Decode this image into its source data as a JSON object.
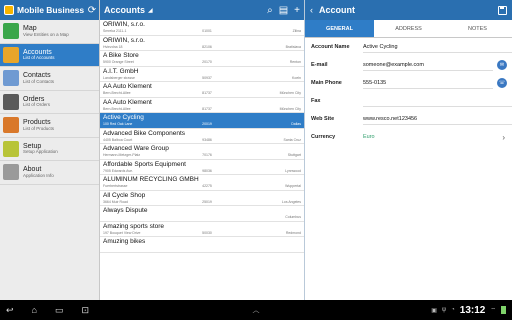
{
  "left": {
    "title": "Mobile Business...",
    "items": [
      {
        "label": "Map",
        "sub": "View Entities on a Map",
        "icon": "map-icon",
        "active": false,
        "color": "#3aa64a"
      },
      {
        "label": "Accounts",
        "sub": "List of Accounts",
        "icon": "accounts-icon",
        "active": true,
        "color": "#e7a52a"
      },
      {
        "label": "Contacts",
        "sub": "List of Contacts",
        "icon": "contacts-icon",
        "active": false,
        "color": "#6f9ad2"
      },
      {
        "label": "Orders",
        "sub": "List of Orders",
        "icon": "orders-icon",
        "active": false,
        "color": "#5a5a5a"
      },
      {
        "label": "Products",
        "sub": "List of Products",
        "icon": "products-icon",
        "active": false,
        "color": "#d9782a"
      },
      {
        "label": "Setup",
        "sub": "Setup Application",
        "icon": "setup-icon",
        "active": false,
        "color": "#b8c438"
      },
      {
        "label": "About",
        "sub": "Application Info",
        "icon": "about-icon",
        "active": false,
        "color": "#9a9a9a"
      }
    ]
  },
  "list": {
    "title": "Accounts",
    "rows": [
      {
        "name": "ORIWIN, s.r.o.",
        "street": "Smreka 2111-1",
        "zip": "01001",
        "city": "Zilina"
      },
      {
        "name": "ORIWIN, s.r.o.",
        "street": "Hviezdna 18",
        "zip": "82106",
        "city": "Bratislava"
      },
      {
        "name": "A Bike Store",
        "street": "5900 Orange Street",
        "zip": "20170",
        "city": "Renton"
      },
      {
        "name": "A.I.T. GmbH",
        "street": "Landsberger strasse",
        "zip": "50937",
        "city": "Koeln"
      },
      {
        "name": "AA Auto Klement",
        "street": "Bern-Brecht-Allee",
        "zip": "81737",
        "city": "München City"
      },
      {
        "name": "AA Auto Klement",
        "street": "Bern-Brecht-Allee",
        "zip": "81737",
        "city": "München City"
      },
      {
        "name": "Active Cycling",
        "street": "100 Red Oak Lane",
        "zip": "20019",
        "city": "Dallas"
      },
      {
        "name": "Advanced Bike Components",
        "street": "4405 Balboa Court",
        "zip": "93486",
        "city": "Santa Cruz"
      },
      {
        "name": "Advanced Ware Group",
        "street": "Hermann-Metzger-Platz",
        "zip": "70176",
        "city": "Stuttgart"
      },
      {
        "name": "Affordable Sports Equipment",
        "street": "7905 Edwards Ave.",
        "zip": "98036",
        "city": "Lynnwood"
      },
      {
        "name": "ALUMINUM RECYCLING GMBH",
        "street": "Fuerbertstrasse",
        "zip": "42275",
        "city": "Wuppertal"
      },
      {
        "name": "All Cycle Shop",
        "street": "3664 Muir Road",
        "zip": "25019",
        "city": "Los Angeles"
      },
      {
        "name": "Always Dispute",
        "street": "",
        "zip": "",
        "city": "Columbus"
      },
      {
        "name": "Amazing sports store",
        "street": "197 Bouquet View Drive",
        "zip": "50030",
        "city": "Redmond"
      },
      {
        "name": "Amuzing bikes",
        "street": "",
        "zip": "",
        "city": ""
      }
    ]
  },
  "detail": {
    "title": "Account",
    "tabs": [
      "GENERAL",
      "ADDRESS",
      "NOTES"
    ],
    "fields": [
      {
        "label": "Account Name",
        "value": "Active Cycling",
        "type": "text"
      },
      {
        "label": "E-mail",
        "value": "someone@example.com",
        "type": "email"
      },
      {
        "label": "Main Phone",
        "value": "555-0135",
        "type": "phone"
      },
      {
        "label": "Fax",
        "value": "",
        "type": "text"
      },
      {
        "label": "Web Site",
        "value": "www.resco.net123456",
        "type": "text"
      },
      {
        "label": "Currency",
        "value": "Euro",
        "type": "link"
      }
    ]
  },
  "sysbar": {
    "time": "13:12"
  },
  "colors": {
    "header": "#2a6fb0",
    "selected": "#2f7dc7"
  }
}
